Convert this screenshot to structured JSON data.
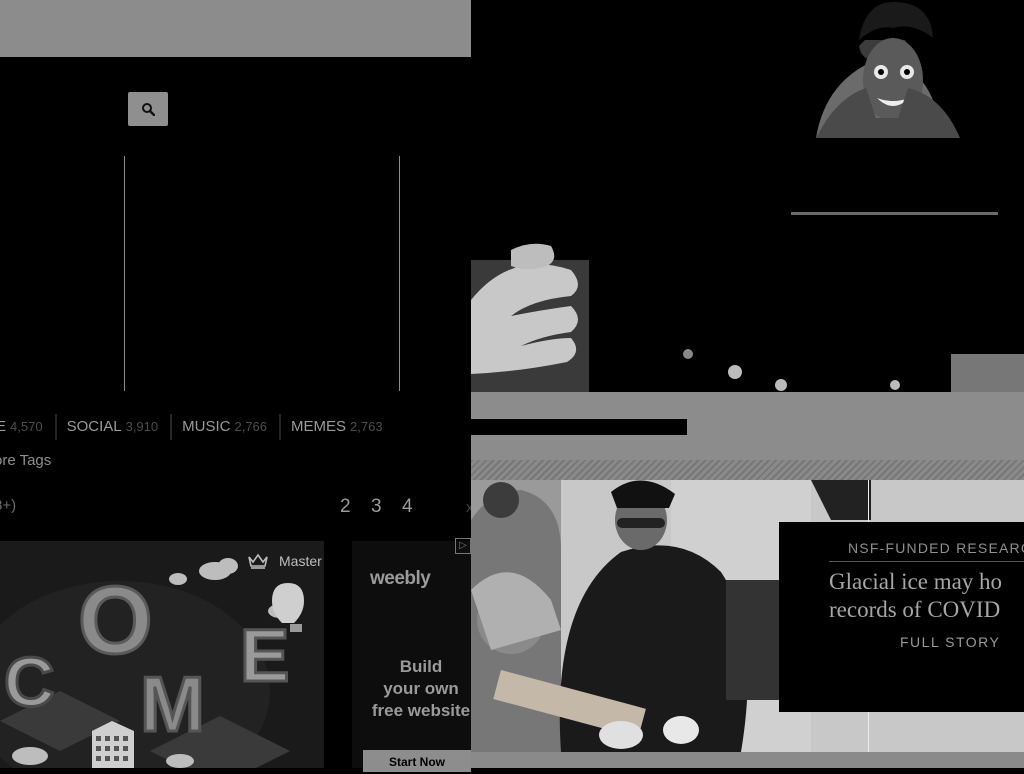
{
  "search": {
    "icon": "search-icon"
  },
  "tags": [
    {
      "label": "E",
      "count": "4,570"
    },
    {
      "label": "SOCIAL",
      "count": "3,910"
    },
    {
      "label": "MUSIC",
      "count": "2,766"
    },
    {
      "label": "MEMES",
      "count": "2,763"
    }
  ],
  "more_tags": "ore Tags",
  "age_label": "8+)",
  "pagination": {
    "pages": [
      "2",
      "3",
      "4"
    ],
    "next": "x"
  },
  "ads": {
    "master_label": "Master",
    "master_icon": "crown-icon",
    "art_letters": [
      "O",
      "C",
      "M",
      "E"
    ],
    "weebly_logo": "weebly",
    "weebly_line1": "Build",
    "weebly_line2": "your own",
    "weebly_line3": "free website",
    "weebly_cta": "Start Now",
    "adchoices": "▷"
  },
  "story": {
    "kicker": "NSF-FUNDED RESEARC",
    "headline_line1": "Glacial ice may ho",
    "headline_line2": "records of COVID",
    "link": "FULL STORY"
  }
}
